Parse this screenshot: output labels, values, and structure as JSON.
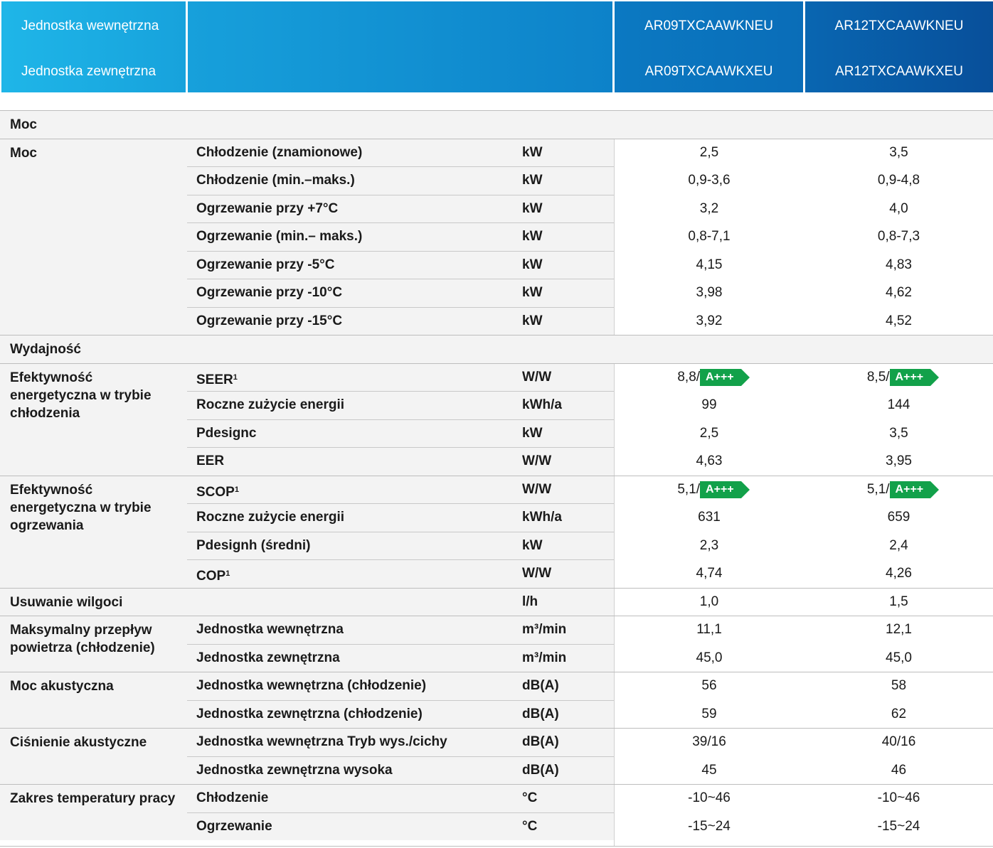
{
  "header": {
    "label_indoor": "Jednostka wewnętrzna",
    "label_outdoor": "Jednostka zewnętrzna",
    "model1_indoor": "AR09TXCAAWKNEU",
    "model1_outdoor": "AR09TXCAAWKXEU",
    "model2_indoor": "AR12TXCAAWKNEU",
    "model2_outdoor": "AR12TXCAAWKXEU"
  },
  "sections": {
    "moc_group": "Moc",
    "wyd_group": "Wydajność"
  },
  "categories": {
    "moc": "Moc",
    "cool_eff": "Efektywność energetyczna w trybie chłodzenia",
    "heat_eff": "Efektywność energetyczna w trybie ogrzewania",
    "dehum": "Usuwanie wilgoci",
    "airflow": "Maksymalny przepływ powietrza (chłodzenie)",
    "sound_power": "Moc akustyczna",
    "sound_pressure": "Ciśnienie akustyczne",
    "temp_range": "Zakres temperatury pracy"
  },
  "energy_label": "A+++",
  "rows": [
    {
      "param": "Chłodzenie (znamionowe)",
      "unit": "kW",
      "v1": "2,5",
      "v2": "3,5"
    },
    {
      "param": "Chłodzenie (min.–maks.)",
      "unit": "kW",
      "v1": "0,9-3,6",
      "v2": "0,9-4,8"
    },
    {
      "param": "Ogrzewanie przy +7°C",
      "unit": "kW",
      "v1": "3,2",
      "v2": "4,0"
    },
    {
      "param": "Ogrzewanie (min.– maks.)",
      "unit": "kW",
      "v1": "0,8-7,1",
      "v2": "0,8-7,3"
    },
    {
      "param": "Ogrzewanie przy -5°C",
      "unit": "kW",
      "v1": "4,15",
      "v2": "4,83"
    },
    {
      "param": "Ogrzewanie przy -10°C",
      "unit": "kW",
      "v1": "3,98",
      "v2": "4,62"
    },
    {
      "param": "Ogrzewanie przy -15°C",
      "unit": "kW",
      "v1": "3,92",
      "v2": "4,52"
    },
    {
      "param": "SEER",
      "sup": "1",
      "unit": "W/W",
      "v1": "8,8/",
      "v2": "8,5/"
    },
    {
      "param": "Roczne zużycie energii",
      "unit": "kWh/a",
      "v1": "99",
      "v2": "144"
    },
    {
      "param": "Pdesignc",
      "unit": "kW",
      "v1": "2,5",
      "v2": "3,5"
    },
    {
      "param": "EER",
      "unit": "W/W",
      "v1": "4,63",
      "v2": "3,95"
    },
    {
      "param": "SCOP",
      "sup": "1",
      "unit": "W/W",
      "v1": "5,1/",
      "v2": "5,1/"
    },
    {
      "param": "Roczne zużycie energii",
      "unit": "kWh/a",
      "v1": "631",
      "v2": "659"
    },
    {
      "param": "Pdesignh (średni)",
      "unit": "kW",
      "v1": "2,3",
      "v2": "2,4"
    },
    {
      "param": "COP",
      "sup": "1",
      "unit": "W/W",
      "v1": "4,74",
      "v2": "4,26"
    },
    {
      "param": "",
      "unit": "l/h",
      "v1": "1,0",
      "v2": "1,5"
    },
    {
      "param": "Jednostka wewnętrzna",
      "unit": "m³/min",
      "v1": "11,1",
      "v2": "12,1"
    },
    {
      "param": "Jednostka zewnętrzna",
      "unit": "m³/min",
      "v1": "45,0",
      "v2": "45,0"
    },
    {
      "param": "Jednostka wewnętrzna (chłodzenie)",
      "unit": "dB(A)",
      "v1": "56",
      "v2": "58"
    },
    {
      "param": "Jednostka zewnętrzna (chłodzenie)",
      "unit": "dB(A)",
      "v1": "59",
      "v2": "62"
    },
    {
      "param": "Jednostka wewnętrzna Tryb wys./cichy",
      "unit": "dB(A)",
      "v1": "39/16",
      "v2": "40/16"
    },
    {
      "param": "Jednostka zewnętrzna wysoka",
      "unit": "dB(A)",
      "v1": "45",
      "v2": "46"
    },
    {
      "param": "Chłodzenie",
      "unit": "°C",
      "v1": "-10~46",
      "v2": "-10~46"
    },
    {
      "param": "Ogrzewanie",
      "unit": "°C",
      "v1": "-15~24",
      "v2": "-15~24"
    }
  ]
}
